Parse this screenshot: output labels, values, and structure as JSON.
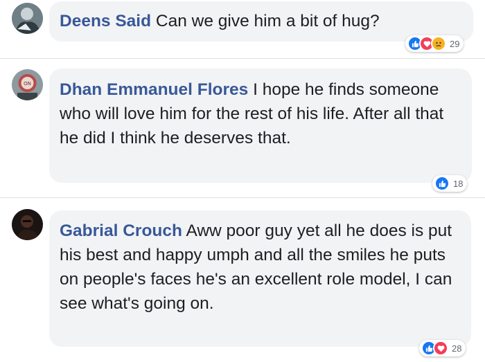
{
  "comments": [
    {
      "author": "Deens Said",
      "text": "Can we give him a bit of hug?",
      "reactions": [
        "like-icon",
        "love-icon",
        "sad-icon"
      ],
      "reaction_count": "29"
    },
    {
      "author": "Dhan Emmanuel Flores",
      "text": "I hope he finds someone who will love him for the rest of his life. After all that he did I think he deserves that.",
      "reactions": [
        "like-icon"
      ],
      "reaction_count": "18"
    },
    {
      "author": "Gabrial Crouch",
      "text": "Aww poor guy yet all he does is put his best and happy umph and all the smiles he puts on people's faces he's an excellent role model, I can see what's going on.",
      "reactions": [
        "like-icon",
        "love-icon"
      ],
      "reaction_count": "28"
    }
  ],
  "colors": {
    "author": "#385898",
    "bubble": "#f2f3f5",
    "like": "#1877f2",
    "love": "#f33e58",
    "sad": "#f7b125"
  }
}
